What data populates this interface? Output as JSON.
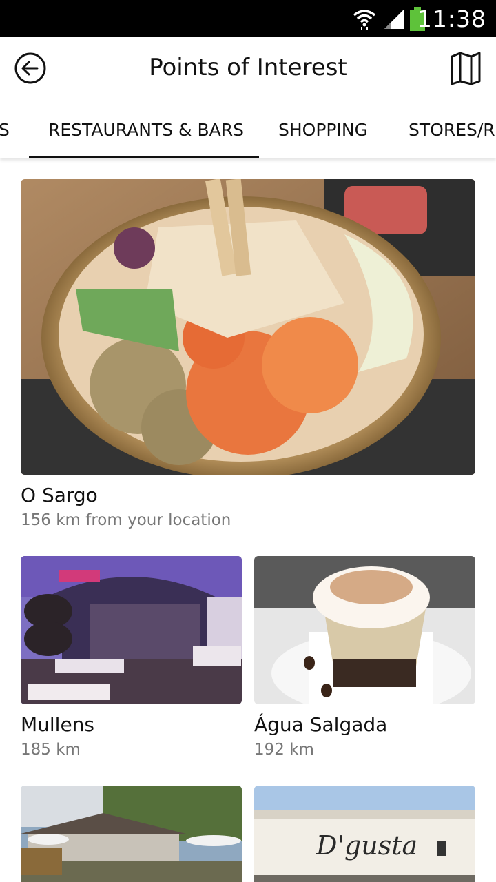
{
  "status_bar": {
    "time": "11:38"
  },
  "app_bar": {
    "title": "Points of Interest"
  },
  "tabs": [
    {
      "label": "S"
    },
    {
      "label": "RESTAURANTS & BARS"
    },
    {
      "label": "SHOPPING"
    },
    {
      "label": "STORES/RE"
    }
  ],
  "selected_tab": "RESTAURANTS & BARS",
  "places": [
    {
      "name": "O Sargo",
      "distance": "156 km from your location"
    },
    {
      "name": "Mullens",
      "distance": "185 km"
    },
    {
      "name": "Água Salgada",
      "distance": "192 km"
    }
  ],
  "partial_cards": [
    {
      "sign_text": "D'gusta"
    }
  ]
}
